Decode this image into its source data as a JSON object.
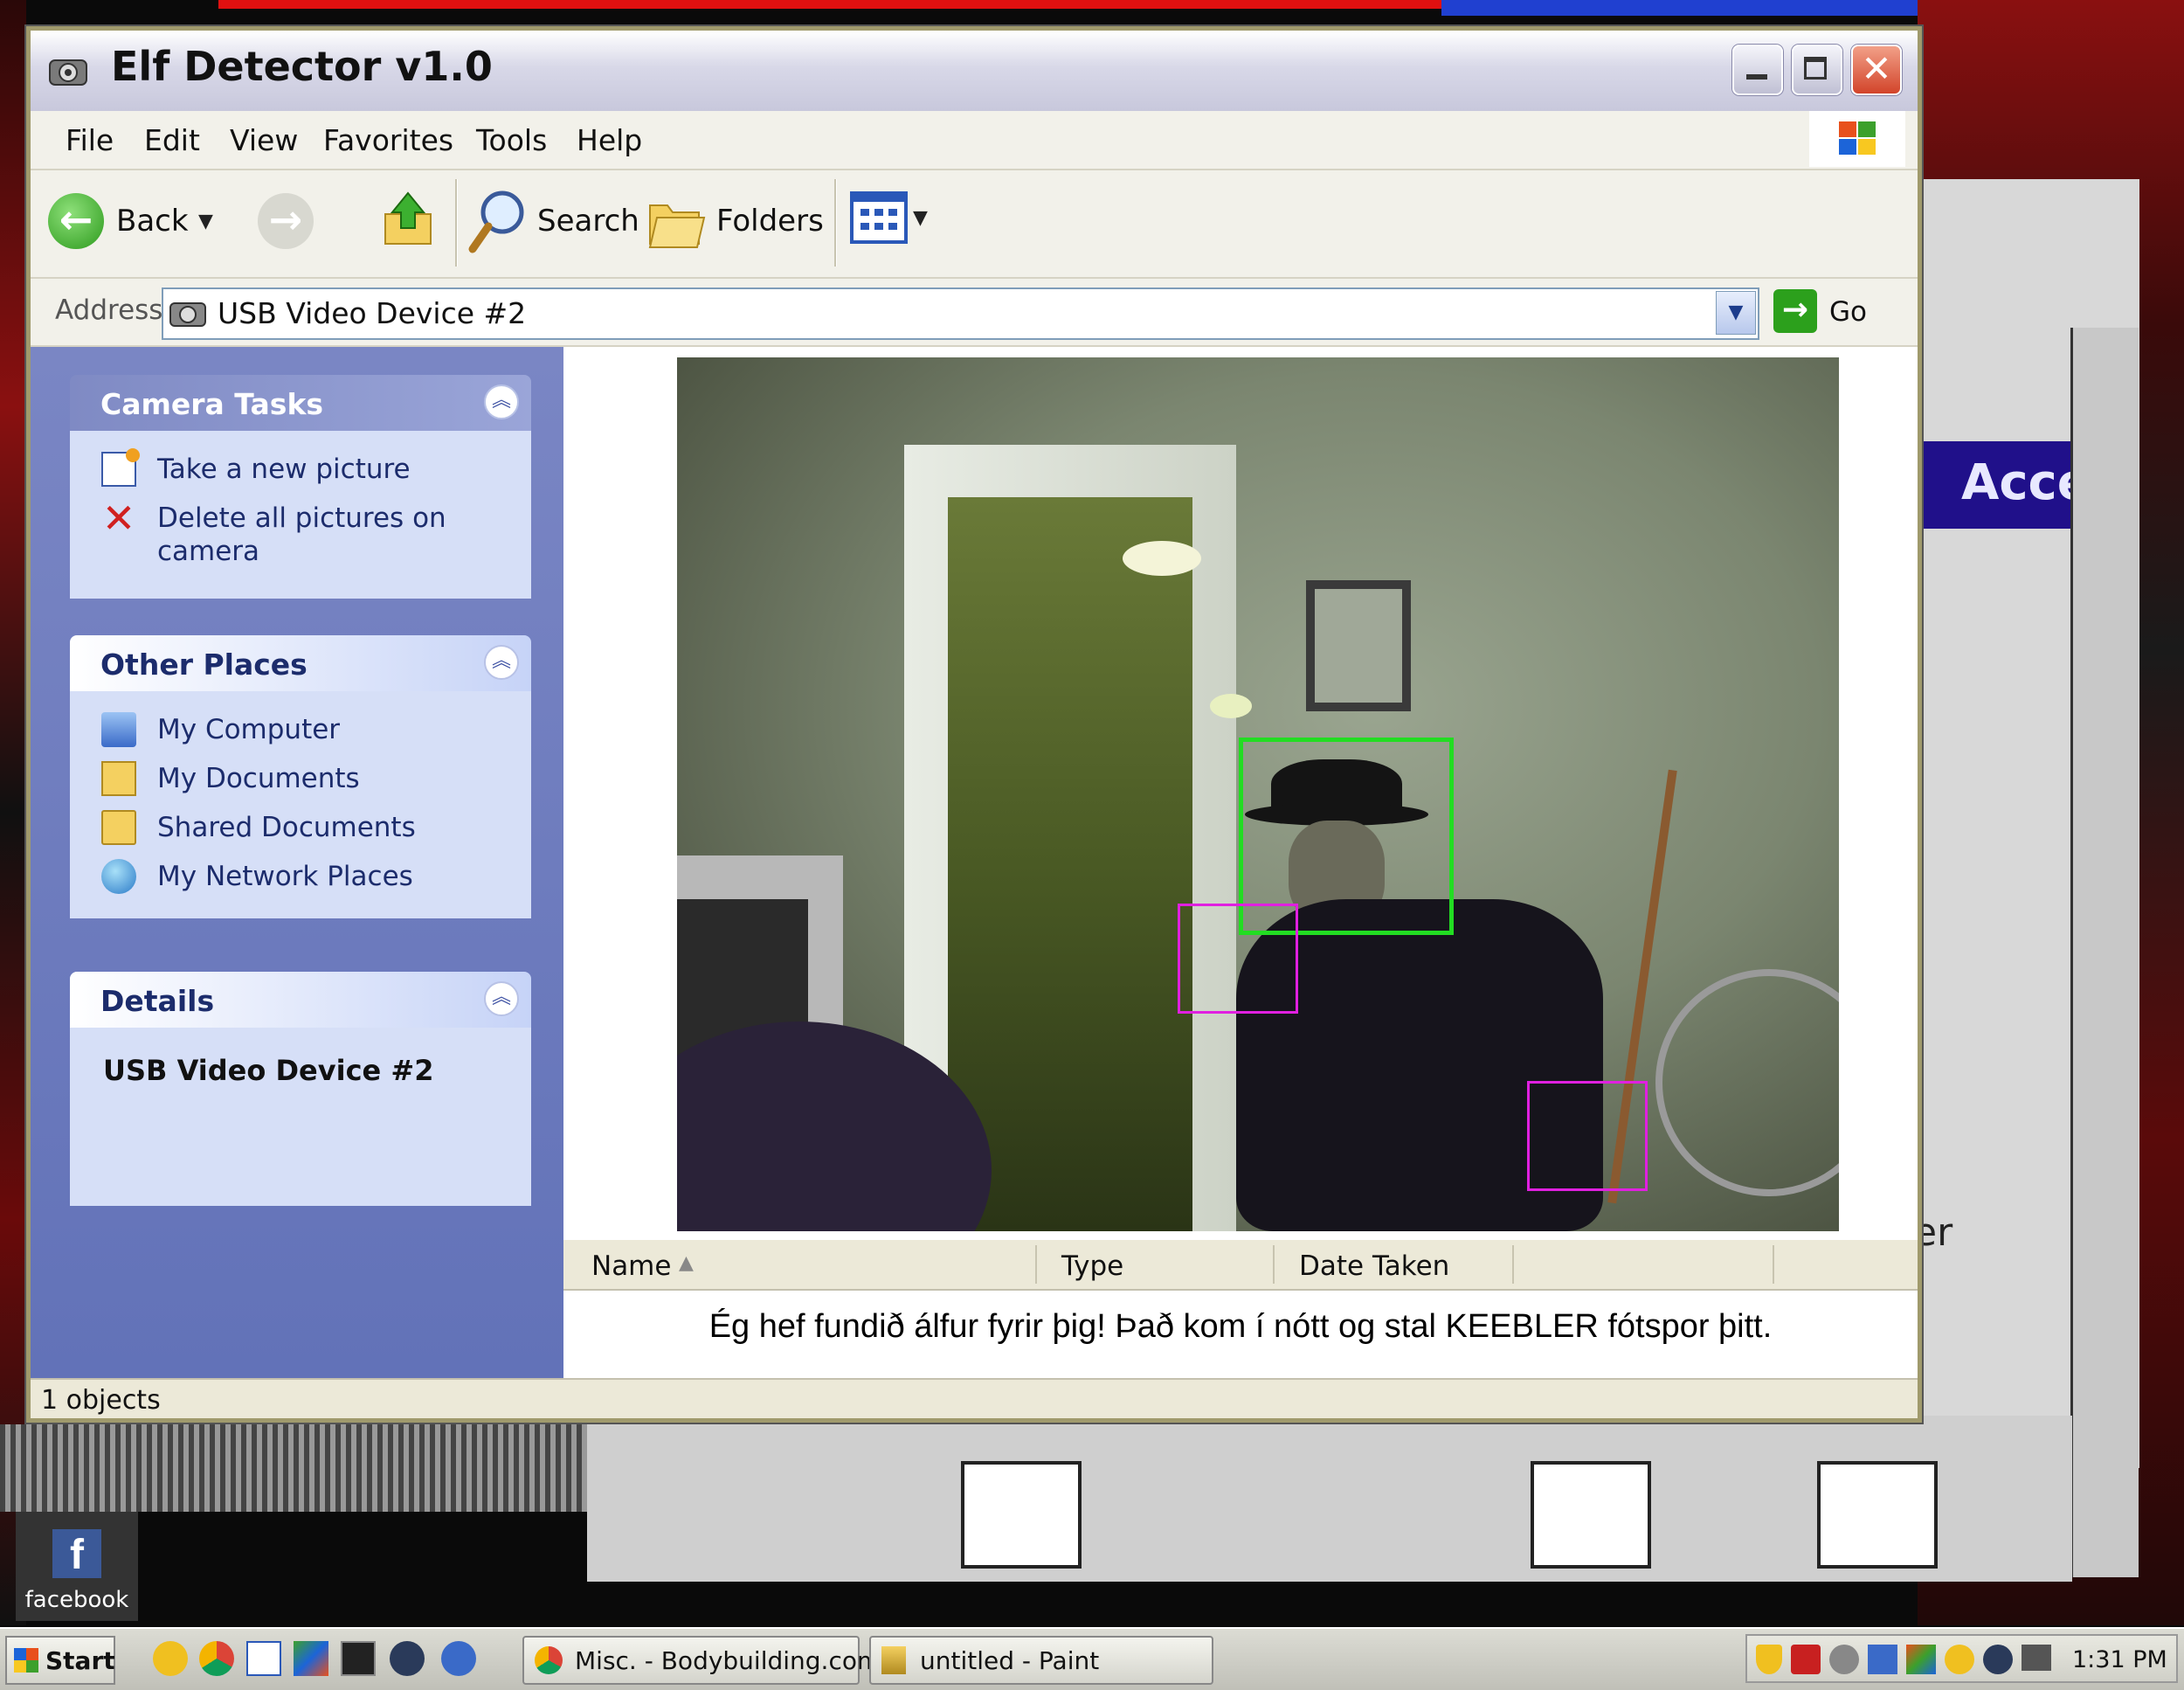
{
  "window": {
    "title": "Elf Detector v1.0",
    "menu": [
      "File",
      "Edit",
      "View",
      "Favorites",
      "Tools",
      "Help"
    ],
    "toolbar": {
      "back": "Back",
      "search": "Search",
      "folders": "Folders"
    },
    "address": {
      "label": "Address",
      "value": "USB Video Device #2",
      "go": "Go"
    }
  },
  "sidebar": {
    "camera_tasks": {
      "title": "Camera Tasks",
      "items": [
        "Take a new picture",
        "Delete all pictures on",
        "camera"
      ]
    },
    "other_places": {
      "title": "Other Places",
      "items": [
        "My Computer",
        "My Documents",
        "Shared Documents",
        "My Network Places"
      ]
    },
    "details": {
      "title": "Details",
      "name": "USB Video Device #2"
    }
  },
  "list": {
    "columns": [
      "Name",
      "Type",
      "Date Taken"
    ],
    "caption": "Ég hef fundið álfur fyrir þig! Það kom í nótt og stal KEEBLER fótspor þitt."
  },
  "status": {
    "objects": "1 objects"
  },
  "desktop": {
    "facebook": "facebook",
    "bg_text_1": "Acce",
    "bg_text_2": "er"
  },
  "taskbar": {
    "start": "Start",
    "tasks": [
      "Misc. - Bodybuilding.com ...",
      "untitled - Paint"
    ],
    "clock": "1:31 PM"
  },
  "colors": {
    "face_box": "#22dd22",
    "hand_box": "#e020e0",
    "xp_blue": "#6272b8"
  }
}
